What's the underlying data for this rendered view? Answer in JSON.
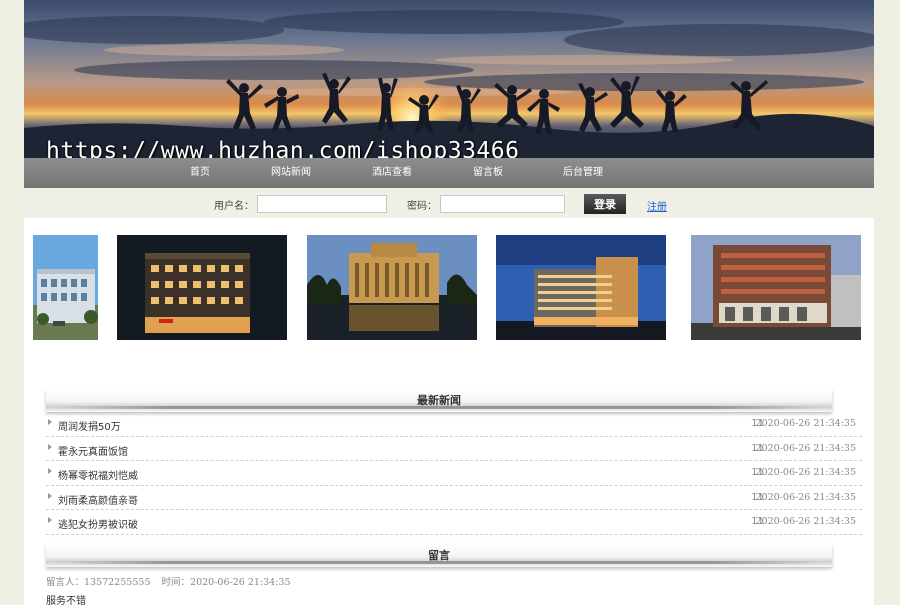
{
  "banner": {
    "watermark": "https://www.huzhan.com/ishop33466"
  },
  "nav": {
    "items": [
      "首页",
      "网站新闻",
      "酒店查看",
      "留言板",
      "后台管理"
    ]
  },
  "login": {
    "username_label": "用户名：",
    "username_value": "",
    "password_label": "密码：",
    "password_value": "",
    "login_button": "登录",
    "register_link": "注册"
  },
  "news": {
    "heading": "最新新闻",
    "items": [
      {
        "title": "周润发捐50万",
        "count": "11",
        "date": "2020-06-26 21:34:35"
      },
      {
        "title": "霍永元真面饭馆",
        "count": "11",
        "date": "2020-06-26 21:34:35"
      },
      {
        "title": "杨幂零祝福刘恺威",
        "count": "11",
        "date": "2020-06-26 21:34:35"
      },
      {
        "title": "刘雨柔高颜值亲哥",
        "count": "11",
        "date": "2020-06-26 21:34:35"
      },
      {
        "title": "逃犯女扮男被识破",
        "count": "11",
        "date": "2020-06-26 21:34:35"
      }
    ]
  },
  "messages": {
    "heading": "留言",
    "items": [
      {
        "author": "留言人：13572255555",
        "time": "时间：2020-06-26 21:34:35",
        "content": "服务不错"
      }
    ]
  },
  "colors": {
    "accent_link": "#1a5fd0",
    "nav_bg": "#808080",
    "page_bg": "#efeee2"
  }
}
